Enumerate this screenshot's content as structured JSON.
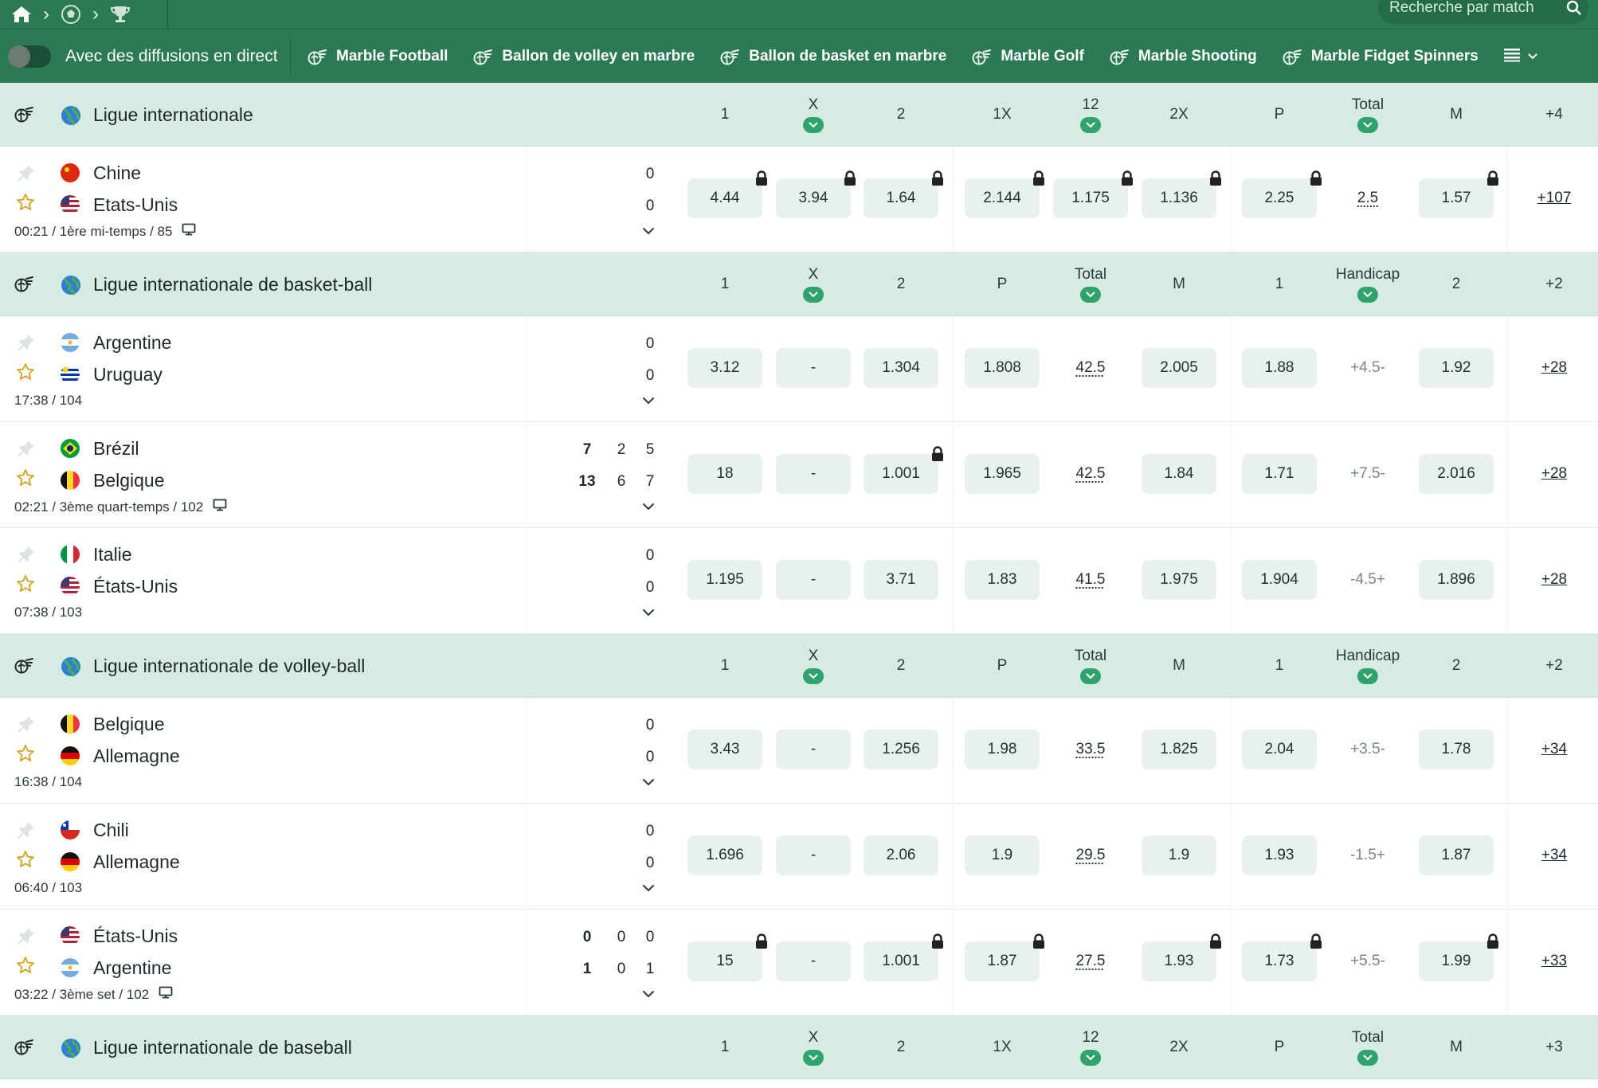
{
  "search": {
    "placeholder": "Recherche par match"
  },
  "live_toggle": {
    "label": "Avec des diffusions en direct"
  },
  "categories": [
    {
      "label": "Marble Football",
      "icon": "marble-icon"
    },
    {
      "label": "Ballon de volley en marbre",
      "icon": "marble-icon"
    },
    {
      "label": "Ballon de basket en marbre",
      "icon": "marble-icon"
    },
    {
      "label": "Marble Golf",
      "icon": "marble-icon"
    },
    {
      "label": "Marble Shooting",
      "icon": "marble-icon"
    },
    {
      "label": "Marble Fidget Spinners",
      "icon": "marble-icon"
    }
  ],
  "colors": {
    "brand": "#2b7a55",
    "league_bg": "#d6ece3",
    "odd_bg": "#e9f1ee",
    "accent": "#2fa36b",
    "star": "#d6a21e"
  },
  "leagues": [
    {
      "name": "Ligue internationale",
      "cols": [
        {
          "label": "1"
        },
        {
          "label": "X",
          "chev": true
        },
        {
          "label": "2"
        },
        {
          "label": "1X"
        },
        {
          "label": "12",
          "chev": true
        },
        {
          "label": "2X"
        },
        {
          "label": "P"
        },
        {
          "label": "Total",
          "chev": true
        },
        {
          "label": "M"
        }
      ],
      "more": "+4",
      "events": [
        {
          "teams": [
            {
              "name": "Chine",
              "flag": "cn"
            },
            {
              "name": "Etats-Unis",
              "flag": "us"
            }
          ],
          "scores": [
            {
              "main": "0"
            },
            {
              "main": "0"
            }
          ],
          "time": "00:21 / 1ère mi-temps / 85",
          "tv": true,
          "odds": [
            {
              "v": "4.44",
              "lock": true
            },
            {
              "v": "3.94",
              "lock": true
            },
            {
              "v": "1.64",
              "lock": true
            },
            {
              "v": "2.144",
              "lock": true
            },
            {
              "v": "1.175",
              "lock": true
            },
            {
              "v": "1.136",
              "lock": true
            },
            {
              "v": "2.25",
              "lock": true
            },
            {
              "v": "2.5",
              "param": true
            },
            {
              "v": "1.57",
              "lock": true
            }
          ],
          "more": "+107"
        }
      ]
    },
    {
      "name": "Ligue internationale de basket-ball",
      "cols": [
        {
          "label": "1"
        },
        {
          "label": "X",
          "chev": true
        },
        {
          "label": "2"
        },
        {
          "label": "P"
        },
        {
          "label": "Total",
          "chev": true
        },
        {
          "label": "M"
        },
        {
          "label": "1"
        },
        {
          "label": "Handicap",
          "chev": true
        },
        {
          "label": "2"
        }
      ],
      "more": "+2",
      "events": [
        {
          "teams": [
            {
              "name": "Argentine",
              "flag": "ar"
            },
            {
              "name": "Uruguay",
              "flag": "uy"
            }
          ],
          "scores": [
            {
              "main": "0"
            },
            {
              "main": "0"
            }
          ],
          "time": "17:38 / 104",
          "tv": false,
          "odds": [
            {
              "v": "3.12"
            },
            {
              "v": "-"
            },
            {
              "v": "1.304"
            },
            {
              "v": "1.808"
            },
            {
              "v": "42.5",
              "param": true
            },
            {
              "v": "2.005"
            },
            {
              "v": "1.88"
            },
            {
              "v": "+4.5-",
              "param": true,
              "hc": true
            },
            {
              "v": "1.92"
            }
          ],
          "more": "+28"
        },
        {
          "teams": [
            {
              "name": "Brézil",
              "flag": "br"
            },
            {
              "name": "Belgique",
              "flag": "be"
            }
          ],
          "scores": [
            {
              "main": "7",
              "p1": "2",
              "p2": "5"
            },
            {
              "main": "13",
              "p1": "6",
              "p2": "7"
            }
          ],
          "time": "02:21 / 3ème quart-temps / 102",
          "tv": true,
          "odds": [
            {
              "v": "18"
            },
            {
              "v": "-"
            },
            {
              "v": "1.001",
              "lock": true
            },
            {
              "v": "1.965"
            },
            {
              "v": "42.5",
              "param": true
            },
            {
              "v": "1.84"
            },
            {
              "v": "1.71"
            },
            {
              "v": "+7.5-",
              "param": true,
              "hc": true
            },
            {
              "v": "2.016"
            }
          ],
          "more": "+28"
        },
        {
          "teams": [
            {
              "name": "Italie",
              "flag": "it"
            },
            {
              "name": "États-Unis",
              "flag": "us"
            }
          ],
          "scores": [
            {
              "main": "0"
            },
            {
              "main": "0"
            }
          ],
          "time": "07:38 / 103",
          "tv": false,
          "odds": [
            {
              "v": "1.195"
            },
            {
              "v": "-"
            },
            {
              "v": "3.71"
            },
            {
              "v": "1.83"
            },
            {
              "v": "41.5",
              "param": true
            },
            {
              "v": "1.975"
            },
            {
              "v": "1.904"
            },
            {
              "v": "-4.5+",
              "param": true,
              "hc": true
            },
            {
              "v": "1.896"
            }
          ],
          "more": "+28"
        }
      ]
    },
    {
      "name": "Ligue internationale de volley-ball",
      "cols": [
        {
          "label": "1"
        },
        {
          "label": "X",
          "chev": true
        },
        {
          "label": "2"
        },
        {
          "label": "P"
        },
        {
          "label": "Total",
          "chev": true
        },
        {
          "label": "M"
        },
        {
          "label": "1"
        },
        {
          "label": "Handicap",
          "chev": true
        },
        {
          "label": "2"
        }
      ],
      "more": "+2",
      "events": [
        {
          "teams": [
            {
              "name": "Belgique",
              "flag": "be"
            },
            {
              "name": "Allemagne",
              "flag": "de"
            }
          ],
          "scores": [
            {
              "main": "0"
            },
            {
              "main": "0"
            }
          ],
          "time": "16:38 / 104",
          "tv": false,
          "odds": [
            {
              "v": "3.43"
            },
            {
              "v": "-"
            },
            {
              "v": "1.256"
            },
            {
              "v": "1.98"
            },
            {
              "v": "33.5",
              "param": true
            },
            {
              "v": "1.825"
            },
            {
              "v": "2.04"
            },
            {
              "v": "+3.5-",
              "param": true,
              "hc": true
            },
            {
              "v": "1.78"
            }
          ],
          "more": "+34"
        },
        {
          "teams": [
            {
              "name": "Chili",
              "flag": "cl"
            },
            {
              "name": "Allemagne",
              "flag": "de"
            }
          ],
          "scores": [
            {
              "main": "0"
            },
            {
              "main": "0"
            }
          ],
          "time": "06:40 / 103",
          "tv": false,
          "odds": [
            {
              "v": "1.696"
            },
            {
              "v": "-"
            },
            {
              "v": "2.06"
            },
            {
              "v": "1.9"
            },
            {
              "v": "29.5",
              "param": true
            },
            {
              "v": "1.9"
            },
            {
              "v": "1.93"
            },
            {
              "v": "-1.5+",
              "param": true,
              "hc": true
            },
            {
              "v": "1.87"
            }
          ],
          "more": "+34"
        },
        {
          "teams": [
            {
              "name": "États-Unis",
              "flag": "us"
            },
            {
              "name": "Argentine",
              "flag": "ar"
            }
          ],
          "scores": [
            {
              "main": "0",
              "p1": "0",
              "p2": "0"
            },
            {
              "main": "1",
              "p1": "0",
              "p2": "1"
            }
          ],
          "time": "03:22 / 3ème set / 102",
          "tv": true,
          "odds": [
            {
              "v": "15",
              "lock": true
            },
            {
              "v": "-"
            },
            {
              "v": "1.001",
              "lock": true
            },
            {
              "v": "1.87",
              "lock": true
            },
            {
              "v": "27.5",
              "param": true
            },
            {
              "v": "1.93",
              "lock": true
            },
            {
              "v": "1.73",
              "lock": true
            },
            {
              "v": "+5.5-",
              "param": true,
              "hc": true
            },
            {
              "v": "1.99",
              "lock": true
            }
          ],
          "more": "+33"
        }
      ]
    },
    {
      "name": "Ligue internationale de baseball",
      "cols": [
        {
          "label": "1"
        },
        {
          "label": "X",
          "chev": true
        },
        {
          "label": "2"
        },
        {
          "label": "1X"
        },
        {
          "label": "12",
          "chev": true
        },
        {
          "label": "2X"
        },
        {
          "label": "P"
        },
        {
          "label": "Total",
          "chev": true
        },
        {
          "label": "M"
        }
      ],
      "more": "+3",
      "events": []
    }
  ]
}
